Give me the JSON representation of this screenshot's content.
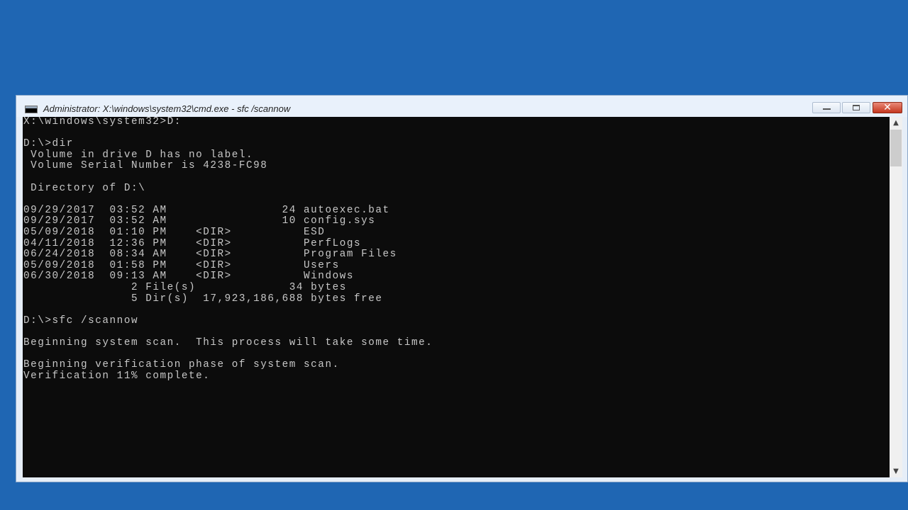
{
  "window": {
    "title": "Administrator: X:\\windows\\system32\\cmd.exe - sfc /scannow",
    "buttons": {
      "minimize": "minimize-icon",
      "maximize": "maximize-icon",
      "close": "close-icon"
    }
  },
  "console": {
    "lines": [
      "X:\\windows\\system32>D:",
      "",
      "D:\\>dir",
      " Volume in drive D has no label.",
      " Volume Serial Number is 4238-FC98",
      "",
      " Directory of D:\\",
      "",
      "09/29/2017  03:52 AM                24 autoexec.bat",
      "09/29/2017  03:52 AM                10 config.sys",
      "05/09/2018  01:10 PM    <DIR>          ESD",
      "04/11/2018  12:36 PM    <DIR>          PerfLogs",
      "06/24/2018  08:34 AM    <DIR>          Program Files",
      "05/09/2018  01:58 PM    <DIR>          Users",
      "06/30/2018  09:13 AM    <DIR>          Windows",
      "               2 File(s)             34 bytes",
      "               5 Dir(s)  17,923,186,688 bytes free",
      "",
      "D:\\>sfc /scannow",
      "",
      "Beginning system scan.  This process will take some time.",
      "",
      "Beginning verification phase of system scan.",
      "Verification 11% complete."
    ]
  },
  "scrollbar": {
    "up_icon": "chevron-up-icon",
    "down_icon": "chevron-down-icon"
  }
}
